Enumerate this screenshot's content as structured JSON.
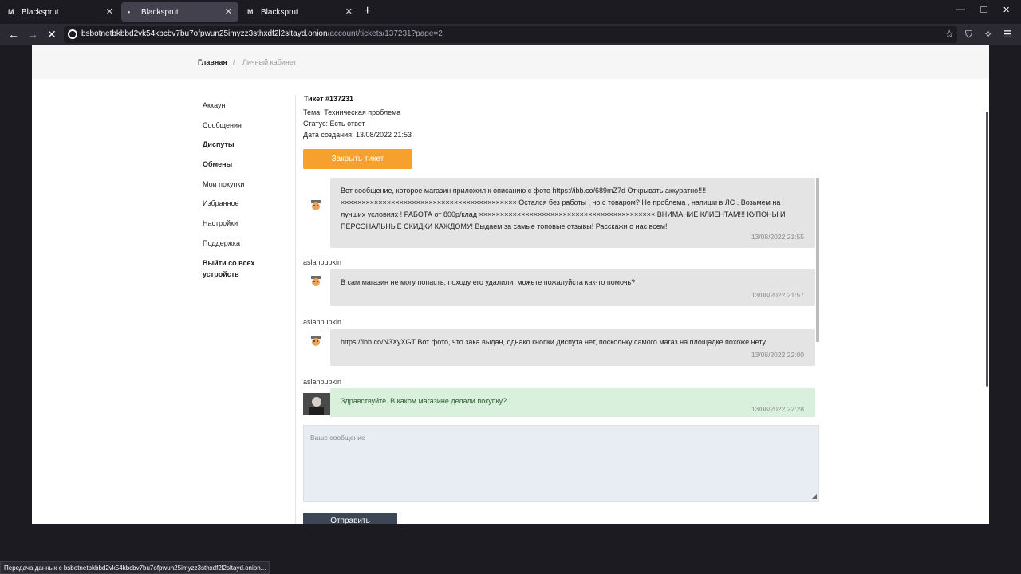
{
  "browser": {
    "tabs": [
      {
        "label": "Blacksprut",
        "active": false
      },
      {
        "label": "Blacksprut",
        "active": true
      },
      {
        "label": "Blacksprut",
        "active": false
      }
    ],
    "url_main": "bsbotnetbkbbd2vk54kbcbv7bu7ofpwun25imyzz3sthxdf2l2sltayd.onion",
    "url_path": "/account/tickets/137231?page=2",
    "status_text": "Передача данных с bsbotnetbkbbd2vk54kbcbv7bu7ofpwun25imyzz3sthxdf2l2sltayd.onion..."
  },
  "breadcrumb": {
    "home": "Главная",
    "separator": "/",
    "current": "Личный кабинет"
  },
  "sidebar": {
    "items": [
      {
        "label": "Аккаунт",
        "bold": false
      },
      {
        "label": "Сообщения",
        "bold": false
      },
      {
        "label": "Диспуты",
        "bold": true
      },
      {
        "label": "Обмены",
        "bold": true
      },
      {
        "label": "Мои покупки",
        "bold": false
      },
      {
        "label": "Избранное",
        "bold": false
      },
      {
        "label": "Настройки",
        "bold": false
      },
      {
        "label": "Поддержка",
        "bold": false
      },
      {
        "label": "Выйти со всех устройств",
        "bold": true
      }
    ]
  },
  "ticket": {
    "title": "Тикет #137231",
    "topic": "Тема: Техническая проблема",
    "status": "Статус: Есть ответ",
    "created": "Дата создания: 13/08/2022 21:53",
    "close_label": "Закрыть тикет"
  },
  "messages": [
    {
      "user": "",
      "text": "Вот сообщение, которое магазин приложил к описанию с фото https://ibb.co/689mZ7d Открывать аккуратно!!!! ×××××××××××××××××××××××××××××××××××××××××× Остался без работы , но с товаром? Не проблема , напиши в ЛС . Возьмем на лучших условиях ! РАБОТА от 800р/клад ×××××××××××××××××××××××××××××××××××××××××× ВНИМАНИЕ КЛИЕНТАМ!!! КУПОНЫ И ПЕРСОНАЛЬНЫЕ СКИДКИ КАЖДОМУ! Выдаем за самые топовые отзывы! Расскажи о нас всем!",
      "time": "13/08/2022 21:55"
    },
    {
      "user": "aslanpupkin",
      "text": "В сам магазин не могу попасть, походу его удалили, можете пожалуйста как-то помочь?",
      "time": "13/08/2022 21:57"
    },
    {
      "user": "aslanpupkin",
      "text": "https://ibb.co/N3XyXGT Вот фото, что зака выдан, однако кнопки диспута нет, поскольку самого магаз на площадке похоже нету",
      "time": "13/08/2022 22:00"
    },
    {
      "user": "aslanpupkin",
      "text": "Здравствуйте. В каком магазине делали покупку?",
      "time": "13/08/2022 22:28"
    }
  ],
  "composer": {
    "placeholder": "Ваше сообщение",
    "send_label": "Отправить"
  },
  "colors": {
    "accent_orange": "#f7a02e",
    "send_button": "#3c4654",
    "bubble_gray": "#e4e4e4",
    "bubble_green": "#d9f0dc",
    "input_bg": "#e8ecf3"
  },
  "icons": {
    "back": "arrow-left-icon",
    "forward": "arrow-right-icon",
    "stop": "stop-loading-icon",
    "bookmark": "star-icon",
    "shield": "shield-icon",
    "extensions": "extension-icon",
    "menu": "hamburger-icon"
  }
}
